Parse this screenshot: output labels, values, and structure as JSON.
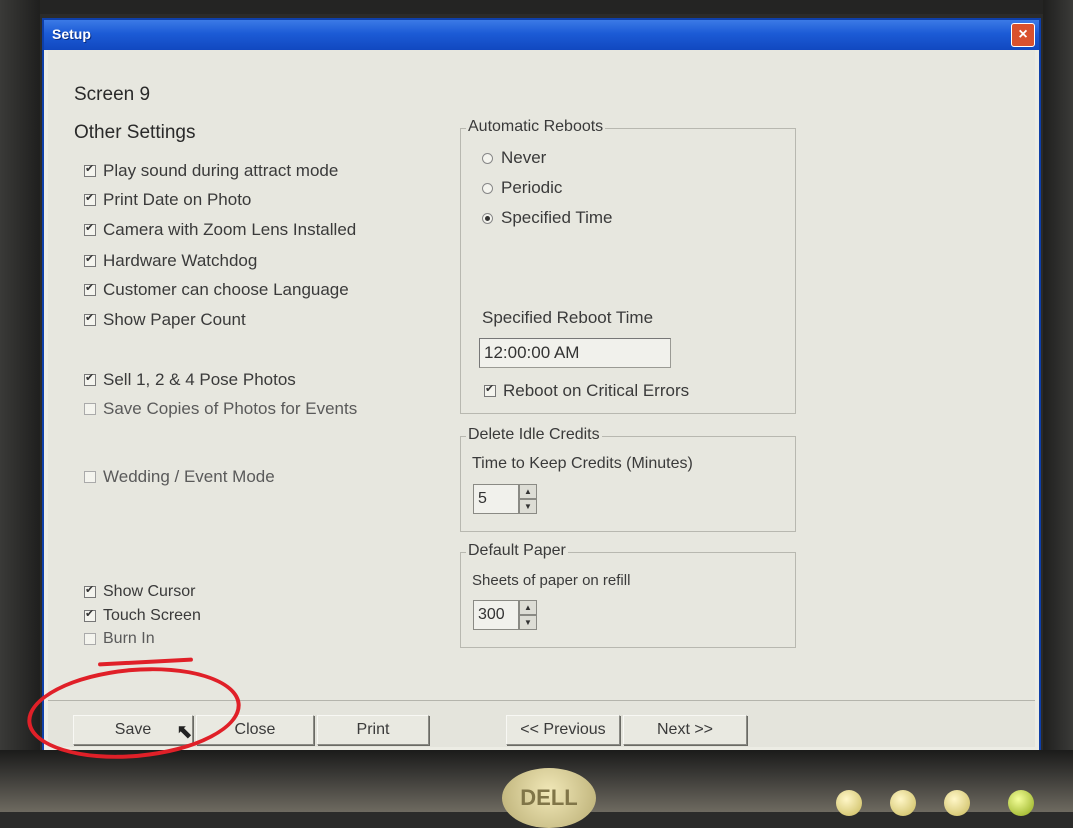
{
  "window": {
    "title": "Setup",
    "close_glyph": "×"
  },
  "screen": {
    "number_label": "Screen 9",
    "section_title": "Other Settings"
  },
  "settings": {
    "play_sound": {
      "label": "Play sound during attract mode",
      "checked": true
    },
    "print_date": {
      "label": "Print Date on Photo",
      "checked": true
    },
    "zoom_lens": {
      "label": "Camera with Zoom Lens Installed",
      "checked": true
    },
    "watchdog": {
      "label": "Hardware Watchdog",
      "checked": true
    },
    "choose_language": {
      "label": "Customer can choose Language",
      "checked": true
    },
    "paper_count": {
      "label": "Show Paper Count",
      "checked": true
    },
    "sell_pose": {
      "label": "Sell 1, 2 & 4 Pose Photos",
      "checked": true
    },
    "save_copies": {
      "label": "Save Copies of Photos for Events",
      "checked": false
    },
    "wedding_mode": {
      "label": "Wedding / Event Mode",
      "checked": false
    },
    "show_cursor": {
      "label": "Show Cursor",
      "checked": true
    },
    "touch_screen": {
      "label": "Touch Screen",
      "checked": true
    },
    "burn_in": {
      "label": "Burn In",
      "checked": false
    }
  },
  "reboots": {
    "legend": "Automatic Reboots",
    "options": {
      "never": "Never",
      "periodic": "Periodic",
      "specified": "Specified Time"
    },
    "selected": "specified",
    "time_label": "Specified Reboot Time",
    "time_value": "12:00:00 AM",
    "critical": {
      "label": "Reboot on Critical Errors",
      "checked": true
    }
  },
  "idle_credits": {
    "legend": "Delete Idle Credits",
    "label": "Time to Keep Credits (Minutes)",
    "value": "5"
  },
  "paper": {
    "legend": "Default Paper",
    "label": "Sheets of paper on refill",
    "value": "300"
  },
  "buttons": {
    "save": "Save",
    "close": "Close",
    "print": "Print",
    "previous": "<< Previous",
    "next": "Next >>"
  },
  "monitor": {
    "brand": "DELL"
  },
  "colors": {
    "annotation": "#e02028",
    "titlebar": "#1c5bd6"
  }
}
